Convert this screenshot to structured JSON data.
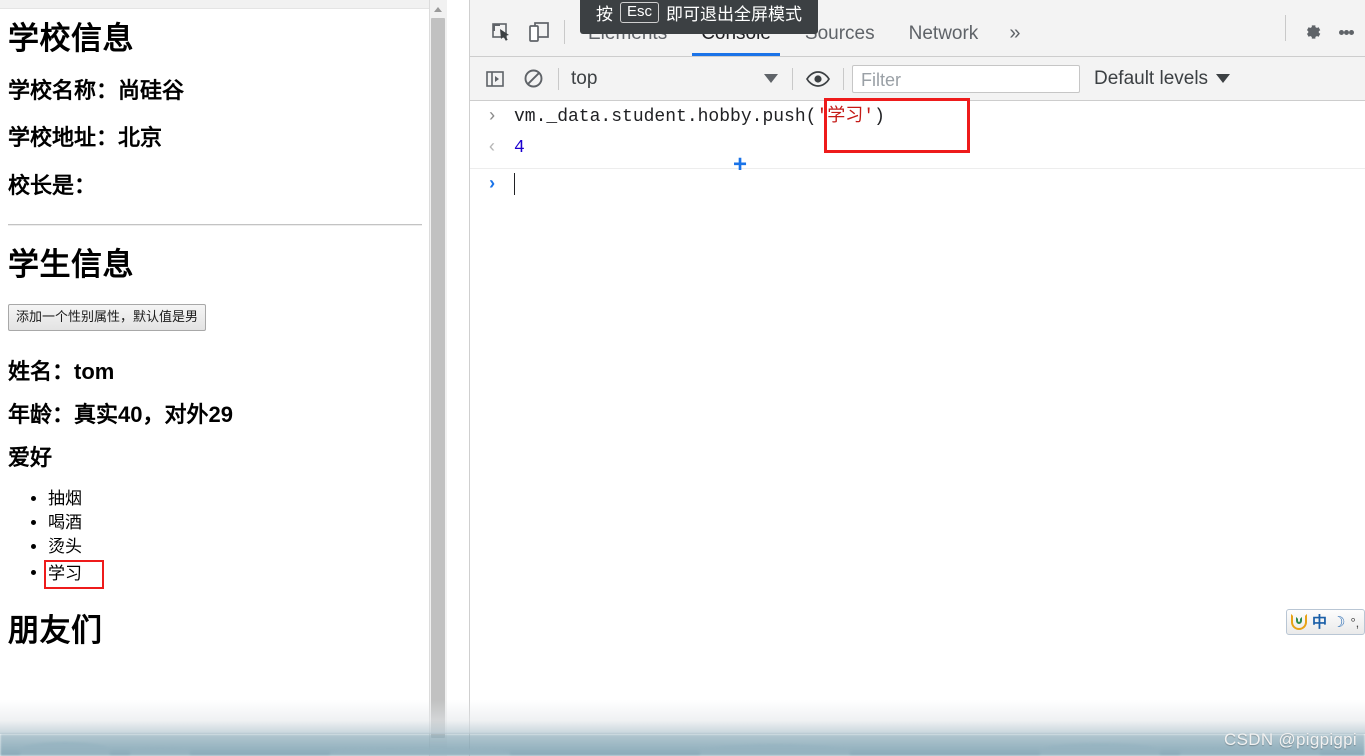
{
  "webpage": {
    "school_section": {
      "heading": "学校信息",
      "name_line": "学校名称：尚硅谷",
      "address_line": "学校地址：北京",
      "principal_line": "校长是："
    },
    "student_section": {
      "heading": "学生信息",
      "add_gender_button": "添加一个性别属性，默认值是男",
      "name_line": "姓名：tom",
      "age_line": "年龄：真实40，对外29",
      "hobby_heading": "爱好",
      "hobby_items": [
        "抽烟",
        "喝酒",
        "烫头",
        "学习"
      ],
      "friends_heading": "朋友们"
    }
  },
  "devtools": {
    "fullscreen_tooltip": {
      "prefix": "按",
      "key": "Esc",
      "suffix": "即可退出全屏模式"
    },
    "icons": {
      "inspect": "inspect-element-icon",
      "device": "device-toolbar-icon",
      "gear": "gear-icon",
      "kebab": "more-options-icon",
      "sidebar_toggle": "console-sidebar-icon",
      "clear": "clear-console-icon",
      "eye": "live-expression-eye-icon"
    },
    "tabs": [
      {
        "label": "Elements",
        "active": false
      },
      {
        "label": "Console",
        "active": true
      },
      {
        "label": "Sources",
        "active": false
      },
      {
        "label": "Network",
        "active": false
      }
    ],
    "more_tabs_label": "»",
    "console_toolbar": {
      "context_value": "top",
      "filter_placeholder": "Filter",
      "filter_value": "",
      "levels_label": "Default levels"
    },
    "console_entries": [
      {
        "kind": "input",
        "gutter": "›",
        "code_prefix": "vm._data.student.hobby.push(",
        "code_string": "'学习'",
        "code_suffix": ")"
      },
      {
        "kind": "output",
        "gutter": "‹",
        "value": "4"
      },
      {
        "kind": "prompt",
        "gutter": "›",
        "value": ""
      }
    ],
    "plus_marker": "+"
  },
  "ime": {
    "logo": "sogou-logo-icon",
    "mode": "中",
    "moon": "☽",
    "punctuation": "°,"
  },
  "watermark": "CSDN @pigpigpi",
  "colors": {
    "accent_blue": "#1a73e8",
    "annotation_red": "#ee1b1b",
    "string_red": "#c41a16",
    "number_blue": "#1c00cf",
    "tooltip_bg": "#3c4043",
    "toolbar_bg": "#f3f3f3"
  }
}
